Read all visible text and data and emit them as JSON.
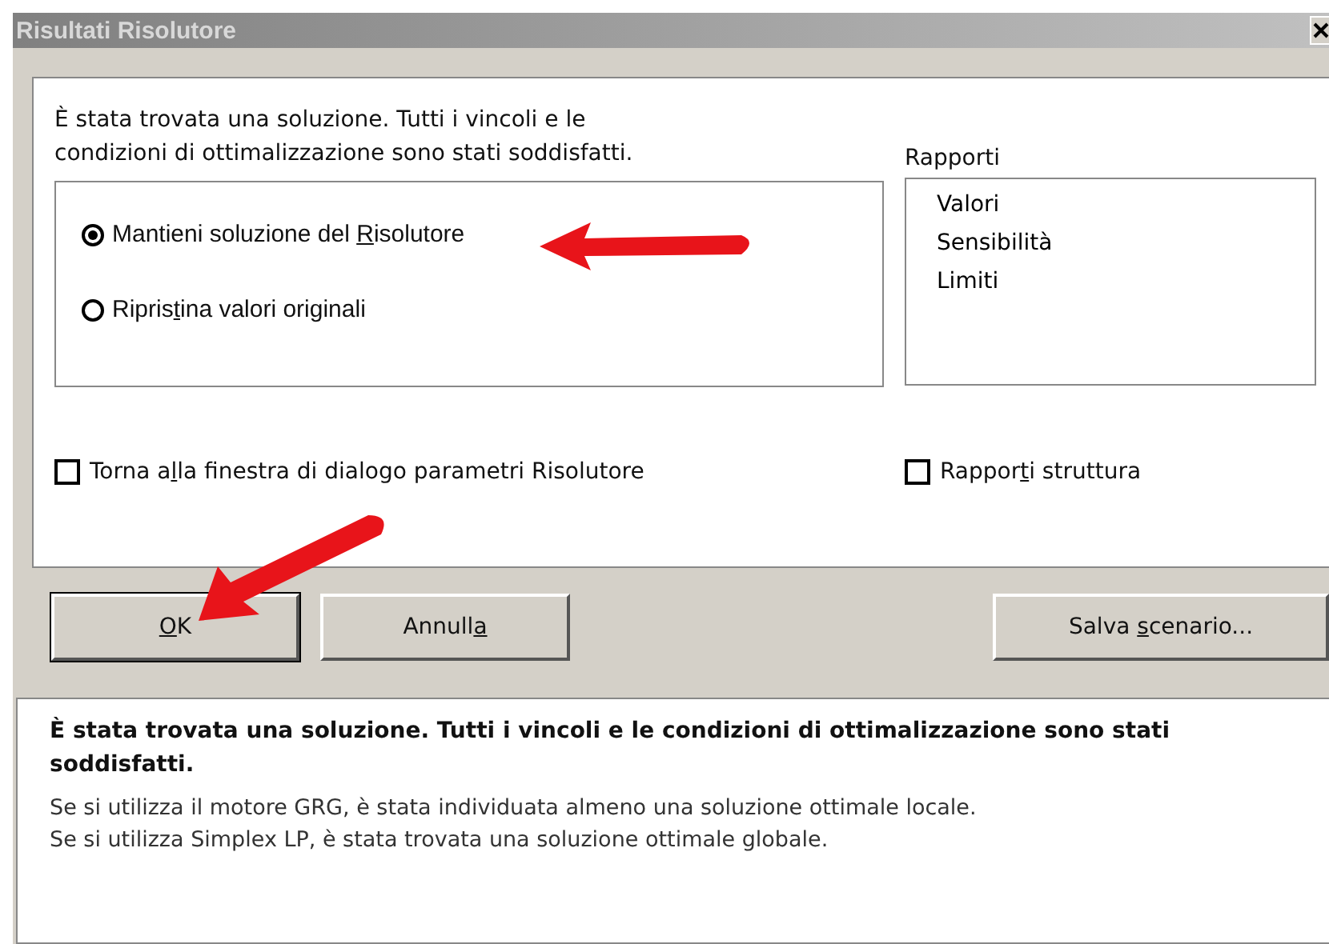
{
  "window": {
    "title": "Risultati Risolutore"
  },
  "message": {
    "lines": [
      "È stata trovata una soluzione. Tutti i vincoli e le",
      "condizioni di ottimalizzazione sono stati soddisfatti."
    ]
  },
  "options": [
    {
      "pre": "Mantieni soluzione del ",
      "key": "R",
      "post": "isolutore",
      "selected": true
    },
    {
      "pre": "Ripris",
      "key": "t",
      "post": "ina valori originali",
      "selected": false
    }
  ],
  "reports": {
    "label": "Rapporti",
    "items": [
      {
        "label": "Valori",
        "selected": false
      },
      {
        "label": "Sensibilità",
        "selected": false
      },
      {
        "label": "Limiti",
        "selected": false
      }
    ]
  },
  "checkboxes": [
    {
      "pre": "Torna a",
      "key": "l",
      "post": "la finestra di dialogo parametri Risolutore",
      "checked": false
    },
    {
      "pre": "Rappor",
      "key": "t",
      "post": "i struttura",
      "checked": false
    }
  ],
  "buttons": [
    {
      "key": "O",
      "post": "K",
      "default": true
    },
    {
      "pre": "Annull",
      "key": "a",
      "default": false
    },
    {
      "pre": "Salva ",
      "key": "s",
      "post": "cenario...",
      "default": false
    }
  ],
  "description": {
    "title": "È stata trovata una soluzione. Tutti i vincoli e le condizioni di ottimalizzazione sono stati soddisfatti.",
    "lines": [
      "Se si utilizza il motore GRG, è stata individuata almeno una soluzione ottimale locale.",
      "Se si utilizza Simplex LP, è stata trovata una soluzione ottimale globale."
    ]
  }
}
